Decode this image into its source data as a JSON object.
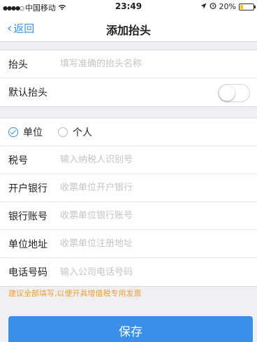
{
  "status_bar": {
    "carrier": "中国移动",
    "time": "23:49",
    "battery_text": "20%",
    "battery_level": 0.2
  },
  "nav": {
    "back_label": "返回",
    "title": "添加抬头"
  },
  "header_section": {
    "title_label": "抬头",
    "title_placeholder": "填写准确的抬头名称",
    "default_label": "默认抬头",
    "default_on": false
  },
  "type_options": [
    {
      "label": "单位",
      "selected": true
    },
    {
      "label": "个人",
      "selected": false
    }
  ],
  "fields": [
    {
      "label": "税号",
      "placeholder": "输入纳税人识别号"
    },
    {
      "label": "开户银行",
      "placeholder": "收票单位开户银行"
    },
    {
      "label": "银行账号",
      "placeholder": "收票单位银行账号"
    },
    {
      "label": "单位地址",
      "placeholder": "收票单位注册地址"
    },
    {
      "label": "电话号码",
      "placeholder": "输入公司电话号码"
    }
  ],
  "hint": "建议全部填写,以便开具增值税专用发票",
  "save_label": "保存"
}
